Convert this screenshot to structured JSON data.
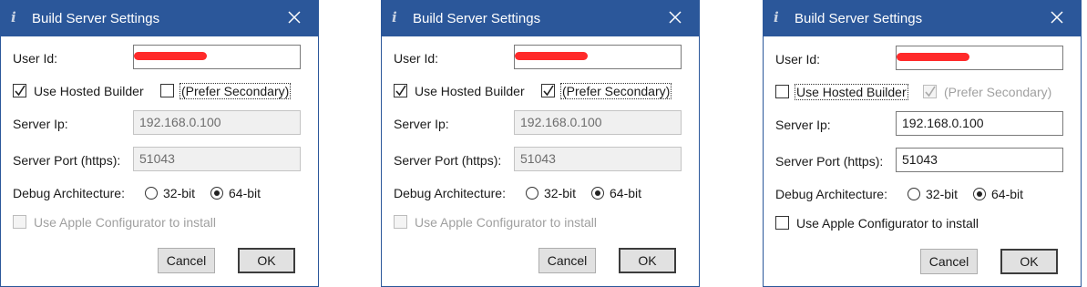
{
  "dialogs": [
    {
      "title": "Build Server Settings",
      "user_id_label": "User Id:",
      "use_hosted_label": "Use Hosted Builder",
      "use_hosted_checked": true,
      "prefer_secondary_label": "(Prefer Secondary)",
      "prefer_secondary_checked": false,
      "server_ip_label": "Server Ip:",
      "server_ip_value": "192.168.0.100",
      "server_port_label": "Server Port (https):",
      "server_port_value": "51043",
      "debug_arch_label": "Debug Architecture:",
      "arch_32_label": "32-bit",
      "arch_64_label": "64-bit",
      "arch_selected": "64-bit",
      "apple_config_label": "Use Apple Configurator to install",
      "apple_config_checked": false,
      "cancel_label": "Cancel",
      "ok_label": "OK"
    },
    {
      "title": "Build Server Settings",
      "user_id_label": "User Id:",
      "use_hosted_label": "Use Hosted Builder",
      "use_hosted_checked": true,
      "prefer_secondary_label": "(Prefer Secondary)",
      "prefer_secondary_checked": true,
      "server_ip_label": "Server Ip:",
      "server_ip_value": "192.168.0.100",
      "server_port_label": "Server Port (https):",
      "server_port_value": "51043",
      "debug_arch_label": "Debug Architecture:",
      "arch_32_label": "32-bit",
      "arch_64_label": "64-bit",
      "arch_selected": "64-bit",
      "apple_config_label": "Use Apple Configurator to install",
      "apple_config_checked": false,
      "cancel_label": "Cancel",
      "ok_label": "OK"
    },
    {
      "title": "Build Server Settings",
      "user_id_label": "User Id:",
      "use_hosted_label": "Use Hosted Builder",
      "use_hosted_checked": false,
      "prefer_secondary_label": "(Prefer Secondary)",
      "prefer_secondary_checked": true,
      "server_ip_label": "Server Ip:",
      "server_ip_value": "192.168.0.100",
      "server_port_label": "Server Port (https):",
      "server_port_value": "51043",
      "debug_arch_label": "Debug Architecture:",
      "arch_32_label": "32-bit",
      "arch_64_label": "64-bit",
      "arch_selected": "64-bit",
      "apple_config_label": "Use Apple Configurator to install",
      "apple_config_checked": false,
      "cancel_label": "Cancel",
      "ok_label": "OK"
    }
  ],
  "colors": {
    "titlebar": "#2b579a",
    "redaction": "#ff2a2a",
    "disabled_text": "#a0a0a0",
    "disabled_field_bg": "#f0f0f0"
  },
  "icons": {
    "title": "info-icon",
    "close": "close-icon",
    "check": "checkmark-icon"
  }
}
